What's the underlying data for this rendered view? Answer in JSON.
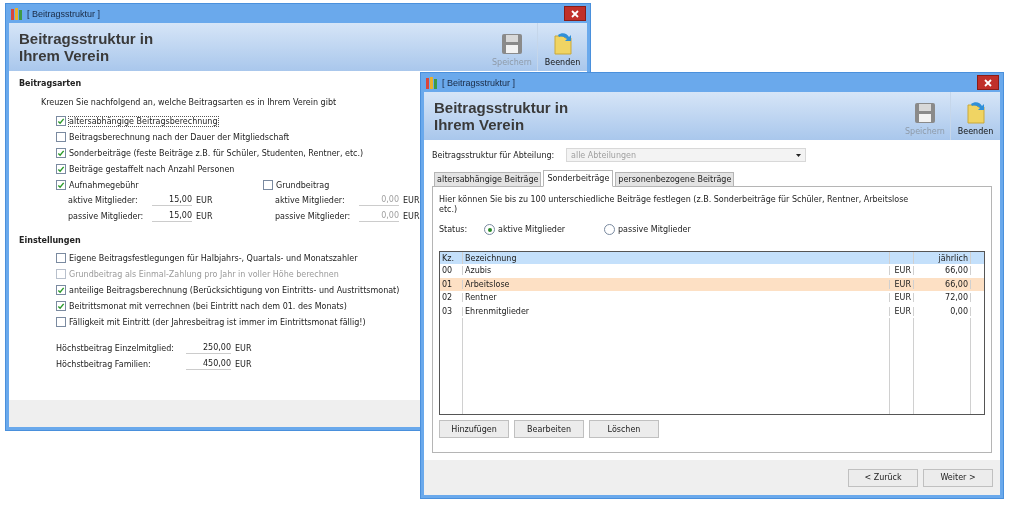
{
  "main_window": {
    "title": "[ Beitragsstruktur ]",
    "heading": [
      "Beitragsstruktur in",
      "Ihrem Verein"
    ],
    "toolbar": [
      {
        "label": "Speichern",
        "kind": "save",
        "disabled": true
      },
      {
        "label": "Beenden",
        "kind": "exit",
        "disabled": false
      }
    ],
    "types_section": {
      "heading": "Beitragsarten",
      "intro": "Kreuzen Sie nachfolgend an, welche Beitragsarten es in Ihrem Verein gibt",
      "options": [
        {
          "label": "altersabhängige Beitragsberechnung",
          "checked": true,
          "disabled": false,
          "focused": true
        },
        {
          "label": "Beitragsberechnung nach der Dauer der Mitgliedschaft",
          "checked": false,
          "disabled": false,
          "focused": false
        },
        {
          "label": "Sonderbeiträge (feste Beiträge z.B. für Schüler, Studenten, Rentner, etc.)",
          "checked": true,
          "disabled": false,
          "focused": false
        },
        {
          "label": "Beiträge gestaffelt nach Anzahl Personen",
          "checked": true,
          "disabled": false,
          "focused": false
        }
      ],
      "fee_groups": [
        {
          "label": "Aufnahmegebühr",
          "checked": true,
          "fields": [
            {
              "label": "aktive Mitglieder:",
              "value": "15,00",
              "unit": "EUR",
              "disabled": false
            },
            {
              "label": "passive Mitglieder:",
              "value": "15,00",
              "unit": "EUR",
              "disabled": false
            }
          ]
        },
        {
          "label": "Grundbeitrag",
          "checked": false,
          "fields": [
            {
              "label": "aktive Mitglieder:",
              "value": "0,00",
              "unit": "EUR",
              "disabled": true
            },
            {
              "label": "passive Mitglieder:",
              "value": "0,00",
              "unit": "EUR",
              "disabled": true
            }
          ]
        }
      ]
    },
    "settings_section": {
      "heading": "Einstellungen",
      "options": [
        {
          "label": "Eigene Beitragsfestlegungen für Halbjahrs-, Quartals- und Monatszahler",
          "checked": false,
          "disabled": false
        },
        {
          "label": "Grundbeitrag als Einmal-Zahlung pro Jahr in voller Höhe berechnen",
          "checked": false,
          "disabled": true
        },
        {
          "label": "anteilige Beitragsberechnung (Berücksichtigung von Eintritts- und Austrittsmonat)",
          "checked": true,
          "disabled": false
        },
        {
          "label": "Beitrittsmonat mit verrechnen (bei Eintritt nach dem 01. des Monats)",
          "checked": true,
          "disabled": false
        },
        {
          "label": "Fälligkeit mit Eintritt (der Jahresbeitrag ist immer im Eintrittsmonat fällig!)",
          "checked": false,
          "disabled": false
        }
      ],
      "fields": [
        {
          "label": "Höchstbeitrag Einzelmitglied:",
          "value": "250,00",
          "unit": "EUR"
        },
        {
          "label": "Höchstbeitrag Familien:",
          "value": "450,00",
          "unit": "EUR"
        }
      ]
    }
  },
  "front_window": {
    "title": "[ Beitragsstruktur ]",
    "heading": [
      "Beitragsstruktur in",
      "Ihrem Verein"
    ],
    "toolbar": [
      {
        "label": "Speichern",
        "kind": "save",
        "disabled": true
      },
      {
        "label": "Beenden",
        "kind": "exit",
        "disabled": false
      }
    ],
    "department": {
      "label": "Beitragsstruktur für Abteilung:",
      "value": "alle Abteilungen",
      "disabled": true
    },
    "tabs": [
      {
        "label": "altersabhängige Beiträge",
        "selected": false
      },
      {
        "label": "Sonderbeiträge",
        "selected": true
      },
      {
        "label": "personenbezogene Beiträge",
        "selected": false
      }
    ],
    "description": "Hier können Sie bis zu 100 unterschiedliche Beiträge festlegen (z.B. Sonderbeiträge für Schüler, Rentner, Arbeitslose etc.)",
    "status": {
      "label": "Status:",
      "options": [
        {
          "label": "aktive Mitglieder",
          "selected": true
        },
        {
          "label": "passive Mitglieder",
          "selected": false
        }
      ]
    },
    "table": {
      "columns": {
        "code": "Kz.",
        "name": "Bezeichnung",
        "amount": "jährlich"
      },
      "rows": [
        {
          "code": "00",
          "name": "Azubis",
          "currency": "EUR",
          "amount": "66,00",
          "selected": false
        },
        {
          "code": "01",
          "name": "Arbeitslose",
          "currency": "EUR",
          "amount": "66,00",
          "selected": true
        },
        {
          "code": "02",
          "name": "Rentner",
          "currency": "EUR",
          "amount": "72,00",
          "selected": false
        },
        {
          "code": "03",
          "name": "Ehrenmitglieder",
          "currency": "EUR",
          "amount": "0,00",
          "selected": false
        }
      ]
    },
    "table_buttons": [
      "Hinzufügen",
      "Bearbeiten",
      "Löschen"
    ],
    "nav_buttons": [
      "< Zurück",
      "Weiter >"
    ]
  }
}
